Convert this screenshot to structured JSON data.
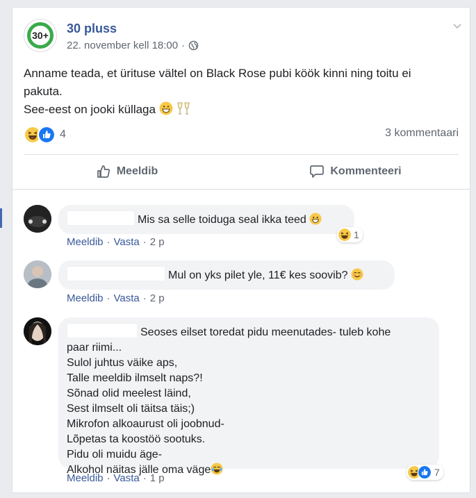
{
  "post": {
    "page_name": "30 pluss",
    "avatar_text": "30+",
    "timestamp": "22. november kell 18:00",
    "separator": "·",
    "text_lines": [
      "Anname teada, et ürituse vältel on Black Rose pubi köök kinni ning toitu ei",
      "pakuta.",
      "See-eest on jooki küllaga"
    ],
    "reaction_count": "4",
    "comment_count": "3 kommentaari",
    "icons": {
      "privacy": "globe-icon",
      "menu": "chevron-down-icon"
    }
  },
  "actions": {
    "like_label": "Meeldib",
    "comment_label": "Kommenteeri"
  },
  "comments": [
    {
      "text": "Mis sa selle toiduga seal ikka teed",
      "like": "Meeldib",
      "reply": "Vasta",
      "time": "2 p",
      "reaction_count": "1"
    },
    {
      "text": "Mul on yks pilet yle, 11€ kes soovib?",
      "like": "Meeldib",
      "reply": "Vasta",
      "time": "2 p"
    },
    {
      "first_line": "Seoses eilset toredat pidu meenutades- tuleb kohe",
      "lines": [
        "paar riimi...",
        "Sulol juhtus väike aps,",
        "Talle meeldib ilmselt naps?!",
        "Sõnad olid meelest läind,",
        "Sest ilmselt oli täitsa täis;)",
        "Mikrofon alkoaurust oli joobnud-",
        "Lõpetas ta koostöö sootuks.",
        "Pidu oli muidu äge-",
        "Alkohol näitas jälle oma väge"
      ],
      "like": "Meeldib",
      "reply": "Vasta",
      "time": "1 p",
      "reaction_count": "7"
    }
  ],
  "colors": {
    "brand_link": "#385898",
    "like_blue": "#1877f2",
    "haha_yellow": "#f7c948",
    "green_ring": "#3aaa4a"
  }
}
